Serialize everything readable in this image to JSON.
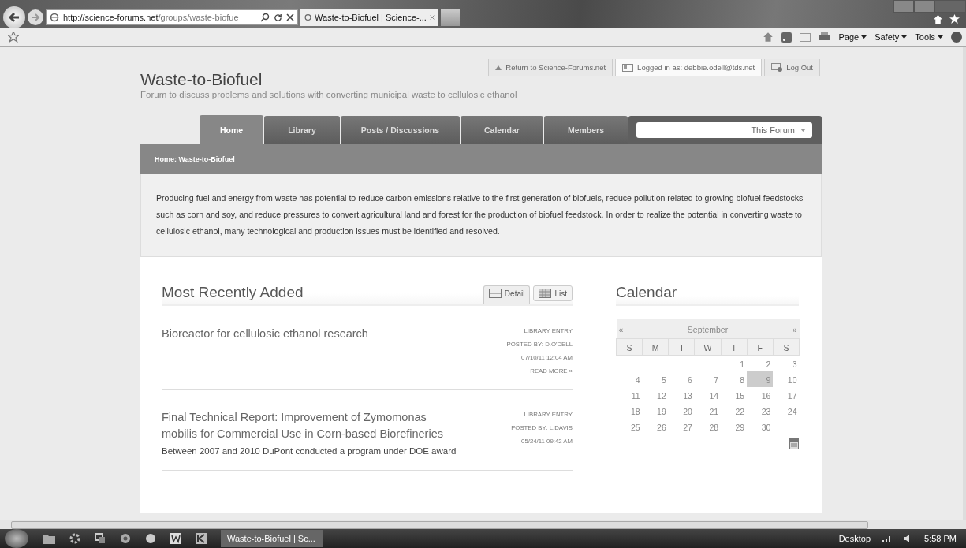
{
  "browser": {
    "url_host": "http://science-forums.net",
    "url_path": "/groups/waste-biofue",
    "tab_title": "Waste-to-Biofuel | Science-...",
    "commands": [
      "Page",
      "Safety",
      "Tools"
    ]
  },
  "top_links": [
    {
      "kind": "return",
      "label": "Return to Science-Forums.net"
    },
    {
      "kind": "user",
      "label": "Logged in as: debbie.odell@tds.net"
    },
    {
      "kind": "logout",
      "label": "Log Out"
    }
  ],
  "site": {
    "title": "Waste-to-Biofuel",
    "subtitle": "Forum to discuss problems and solutions with converting municipal waste to cellulosic ethanol"
  },
  "tabs": [
    {
      "label": "Home",
      "selected": true
    },
    {
      "label": "Library",
      "selected": false
    },
    {
      "label": "Posts / Discussions",
      "selected": false
    },
    {
      "label": "Calendar",
      "selected": false
    },
    {
      "label": "Members",
      "selected": false
    }
  ],
  "search": {
    "scope": "This Forum"
  },
  "breadcrumb": "Home: Waste-to-Biofuel",
  "description": "Producing fuel and energy from waste has potential to reduce carbon emissions relative to the first generation of biofuels, reduce pollution related to growing biofuel feedstocks such as corn and soy, and reduce pressures to convert agricultural land and forest for the production of biofuel feedstock. In order to realize the potential in converting waste to cellulosic ethanol, many technological and production issues must be identified and resolved.",
  "recent": {
    "title": "Most Recently Added",
    "views": [
      {
        "kind": "detail",
        "label": "Detail",
        "selected": true
      },
      {
        "kind": "list",
        "label": "List",
        "selected": false
      }
    ],
    "entries": [
      {
        "title": "Bioreactor for cellulosic ethanol research",
        "type": "LIBRARY ENTRY",
        "posted_by": "POSTED BY: D.O'DELL",
        "date": "07/10/11 12:04 AM",
        "read_more": "READ MORE »"
      },
      {
        "title": "Final Technical Report: Improvement of Zymomonas mobilis for Commercial Use in Corn-based Biorefineries",
        "excerpt": "Between 2007 and 2010 DuPont conducted a program under DOE award",
        "type": "LIBRARY ENTRY",
        "posted_by": "POSTED BY: L.DAVIS",
        "date": "05/24/11 09:42 AM"
      }
    ]
  },
  "calendar": {
    "title": "Calendar",
    "prev": "«",
    "month": "September",
    "next": "»",
    "weekdays": [
      "S",
      "M",
      "T",
      "W",
      "T",
      "F",
      "S"
    ],
    "weeks": [
      [
        {
          "day": "1",
          "selected": false
        },
        {
          "day": "2",
          "selected": false
        },
        {
          "day": "3",
          "selected": false
        }
      ],
      [
        {
          "day": "4",
          "selected": false
        },
        {
          "day": "5",
          "selected": false
        },
        {
          "day": "6",
          "selected": false
        },
        {
          "day": "7",
          "selected": false
        },
        {
          "day": "8",
          "selected": false
        },
        {
          "day": "9",
          "selected": true
        },
        {
          "day": "10",
          "selected": false
        }
      ],
      [
        {
          "day": "11",
          "selected": false
        },
        {
          "day": "12",
          "selected": false
        },
        {
          "day": "13",
          "selected": false
        },
        {
          "day": "14",
          "selected": false
        },
        {
          "day": "15",
          "selected": false
        },
        {
          "day": "16",
          "selected": false
        },
        {
          "day": "17",
          "selected": false
        }
      ],
      [
        {
          "day": "18",
          "selected": false
        },
        {
          "day": "19",
          "selected": false
        },
        {
          "day": "20",
          "selected": false
        },
        {
          "day": "21",
          "selected": false
        },
        {
          "day": "22",
          "selected": false
        },
        {
          "day": "23",
          "selected": false
        },
        {
          "day": "24",
          "selected": false
        }
      ],
      [
        {
          "day": "25",
          "selected": false
        },
        {
          "day": "26",
          "selected": false
        },
        {
          "day": "27",
          "selected": false
        },
        {
          "day": "28",
          "selected": false
        },
        {
          "day": "29",
          "selected": false
        },
        {
          "day": "30",
          "selected": false
        }
      ]
    ]
  },
  "taskbar": {
    "window": "Waste-to-Biofuel | Sc...",
    "desktop": "Desktop",
    "clock": "5:58 PM"
  }
}
